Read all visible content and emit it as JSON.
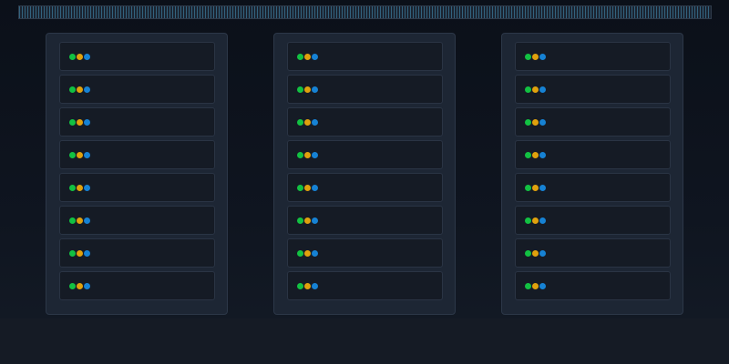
{
  "colors": {
    "led_power": "#12c142",
    "led_activity": "#e0a10d",
    "led_network": "#1682d4"
  },
  "racks": [
    {
      "units": [
        {
          "leds": [
            "led_power",
            "led_activity",
            "led_network"
          ]
        },
        {
          "leds": [
            "led_power",
            "led_activity",
            "led_network"
          ]
        },
        {
          "leds": [
            "led_power",
            "led_activity",
            "led_network"
          ]
        },
        {
          "leds": [
            "led_power",
            "led_activity",
            "led_network"
          ]
        },
        {
          "leds": [
            "led_power",
            "led_activity",
            "led_network"
          ]
        },
        {
          "leds": [
            "led_power",
            "led_activity",
            "led_network"
          ]
        },
        {
          "leds": [
            "led_power",
            "led_activity",
            "led_network"
          ]
        },
        {
          "leds": [
            "led_power",
            "led_activity",
            "led_network"
          ]
        }
      ]
    },
    {
      "units": [
        {
          "leds": [
            "led_power",
            "led_activity",
            "led_network"
          ]
        },
        {
          "leds": [
            "led_power",
            "led_activity",
            "led_network"
          ]
        },
        {
          "leds": [
            "led_power",
            "led_activity",
            "led_network"
          ]
        },
        {
          "leds": [
            "led_power",
            "led_activity",
            "led_network"
          ]
        },
        {
          "leds": [
            "led_power",
            "led_activity",
            "led_network"
          ]
        },
        {
          "leds": [
            "led_power",
            "led_activity",
            "led_network"
          ]
        },
        {
          "leds": [
            "led_power",
            "led_activity",
            "led_network"
          ]
        },
        {
          "leds": [
            "led_power",
            "led_activity",
            "led_network"
          ]
        }
      ]
    },
    {
      "units": [
        {
          "leds": [
            "led_power",
            "led_activity",
            "led_network"
          ]
        },
        {
          "leds": [
            "led_power",
            "led_activity",
            "led_network"
          ]
        },
        {
          "leds": [
            "led_power",
            "led_activity",
            "led_network"
          ]
        },
        {
          "leds": [
            "led_power",
            "led_activity",
            "led_network"
          ]
        },
        {
          "leds": [
            "led_power",
            "led_activity",
            "led_network"
          ]
        },
        {
          "leds": [
            "led_power",
            "led_activity",
            "led_network"
          ]
        },
        {
          "leds": [
            "led_power",
            "led_activity",
            "led_network"
          ]
        },
        {
          "leds": [
            "led_power",
            "led_activity",
            "led_network"
          ]
        }
      ]
    }
  ]
}
